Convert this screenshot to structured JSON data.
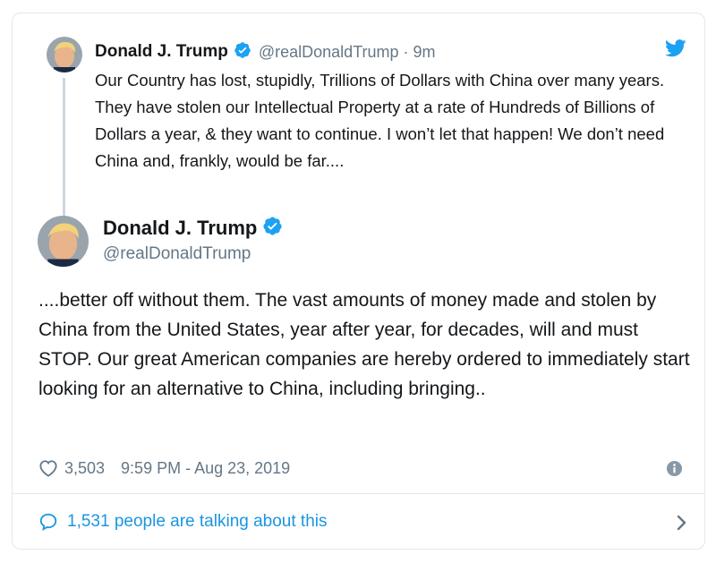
{
  "colors": {
    "text": "#14171a",
    "secondary": "#657786",
    "link": "#1b95e0",
    "verified": "#1da1f2",
    "border": "#e1e8ed"
  },
  "parent_tweet": {
    "name": "Donald J. Trump",
    "handle": "@realDonaldTrump",
    "separator": "·",
    "time": "9m",
    "text": "Our Country has lost, stupidly, Trillions of Dollars with China over many years. They have stolen our Intellectual Property at a rate of Hundreds of Billions of Dollars a year, & they want to continue. I won’t let that happen! We don’t need China and, frankly, would be far....",
    "icons": [
      "avatar",
      "verified-badge-icon",
      "twitter-bird-icon"
    ]
  },
  "main_tweet": {
    "name": "Donald J. Trump",
    "handle": "@realDonaldTrump",
    "text": "....better off without them. The vast amounts of money made and stolen by China from the United States, year after year, for decades, will and must STOP. Our great American companies are hereby ordered to immediately start looking for an alternative to China, including bringing..",
    "likes": "3,503",
    "timestamp": "9:59 PM - Aug 23, 2019",
    "icons": [
      "avatar",
      "verified-badge-icon",
      "heart-icon",
      "info-icon"
    ]
  },
  "footer": {
    "talking_text": "1,531 people are talking about this",
    "icons": [
      "speech-bubble-icon",
      "chevron-right-icon"
    ]
  }
}
